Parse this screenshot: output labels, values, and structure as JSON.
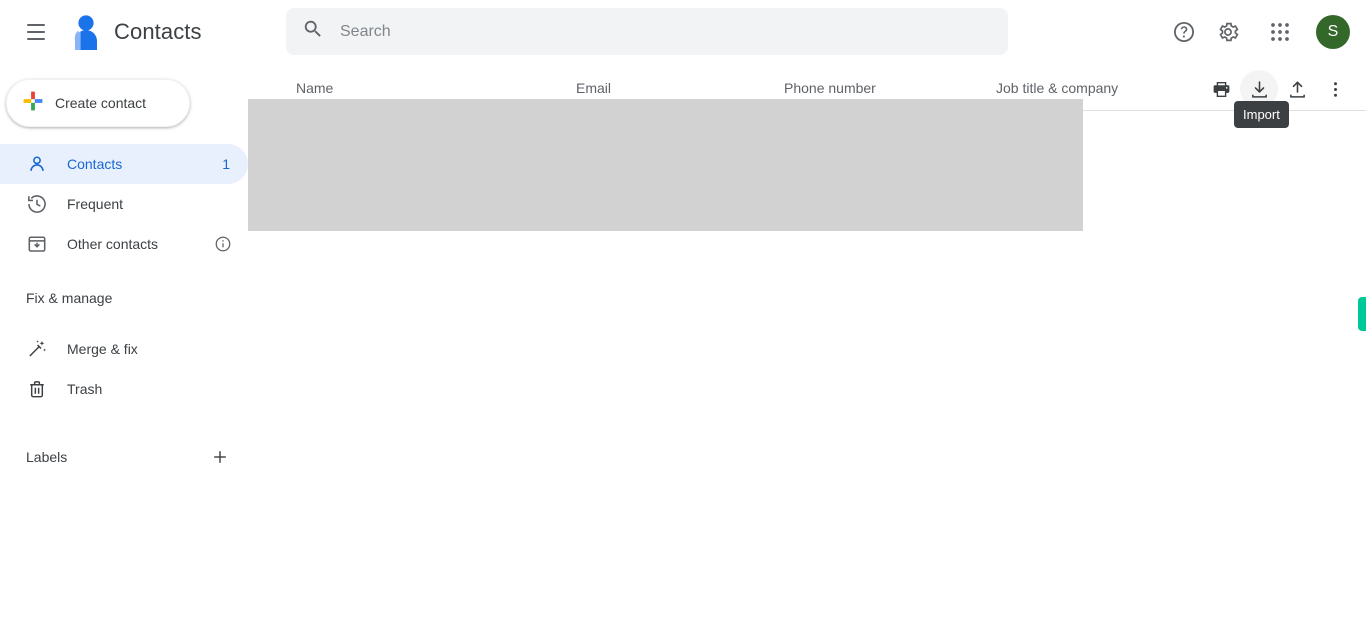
{
  "app": {
    "title": "Contacts",
    "logo_icon": "contacts-person-logo",
    "menu_icon": "hamburger-menu-icon"
  },
  "search": {
    "placeholder": "Search",
    "value": "",
    "icon": "search-icon"
  },
  "top_actions": [
    {
      "name": "help",
      "icon": "help-circle-icon"
    },
    {
      "name": "settings",
      "icon": "gear-icon"
    },
    {
      "name": "google-apps",
      "icon": "apps-grid-icon"
    }
  ],
  "account": {
    "initial": "S",
    "color": "#34672a"
  },
  "sidebar": {
    "create_button": {
      "label": "Create contact",
      "icon": "google-plus-icon"
    },
    "items": [
      {
        "label": "Contacts",
        "icon": "person-icon",
        "badge": "1",
        "active": true
      },
      {
        "label": "Frequent",
        "icon": "history-clock-icon",
        "badge": "",
        "active": false
      },
      {
        "label": "Other contacts",
        "icon": "archive-box-icon",
        "badge": "",
        "active": false,
        "info_icon": "info-circle-icon"
      }
    ],
    "fix_manage": {
      "title": "Fix & manage",
      "items": [
        {
          "label": "Merge & fix",
          "icon": "magic-wand-icon"
        },
        {
          "label": "Trash",
          "icon": "trash-icon"
        }
      ]
    },
    "labels": {
      "title": "Labels",
      "add_icon": "plus-icon"
    }
  },
  "table": {
    "columns": {
      "name": "Name",
      "email": "Email",
      "phone": "Phone number",
      "job": "Job title & company"
    },
    "rows": [],
    "actions": [
      {
        "name": "print",
        "icon": "printer-icon"
      },
      {
        "name": "import",
        "icon": "download-icon"
      },
      {
        "name": "export",
        "icon": "upload-icon"
      },
      {
        "name": "more",
        "icon": "more-vertical-icon"
      }
    ]
  },
  "tooltip": {
    "text": "Import"
  },
  "colors": {
    "accent_blue": "#1967d2",
    "active_bg": "#e8f0fe",
    "tooltip_bg": "#3c4043",
    "placeholder_gray": "#d2d2d2",
    "edge_tab_green": "#00c999",
    "avatar_green": "#34672a"
  }
}
